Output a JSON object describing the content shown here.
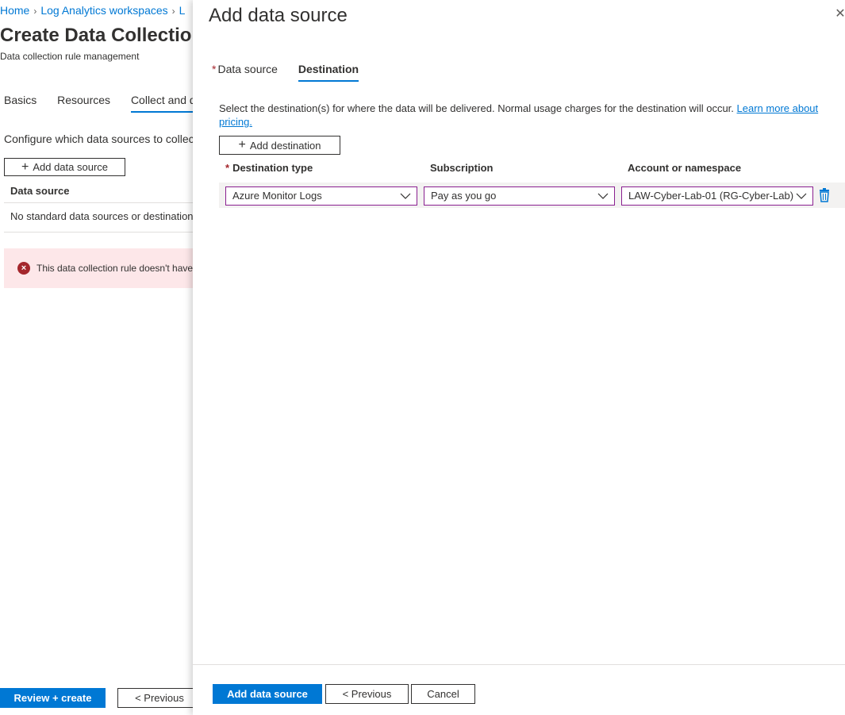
{
  "background": {
    "breadcrumb": [
      "Home",
      "Log Analytics workspaces",
      "L"
    ],
    "title": "Create Data Collection",
    "subtitle": "Data collection rule management",
    "tabs": [
      "Basics",
      "Resources",
      "Collect and de"
    ],
    "description": "Configure which data sources to collec",
    "add_button": "Add data source",
    "table_header": "Data source",
    "empty_row": "No standard data sources or destination",
    "error_text": "This data collection rule doesn't have",
    "footer": {
      "primary": "Review + create",
      "previous": "< Previous"
    }
  },
  "blade": {
    "title": "Add data source",
    "tabs": [
      {
        "label": "Data source",
        "required": "*"
      },
      {
        "label": "Destination"
      }
    ],
    "description": "Select the destination(s) for where the data will be delivered. Normal usage charges for the destination will occur.",
    "learn_more": "Learn more about pricing.",
    "add_destination": "Add destination",
    "columns": {
      "type": "Destination type",
      "type_required": "*",
      "subscription": "Subscription",
      "account": "Account or namespace"
    },
    "row": {
      "type": "Azure Monitor Logs",
      "subscription": "Pay as you go",
      "account": "LAW-Cyber-Lab-01 (RG-Cyber-Lab)"
    },
    "footer": {
      "primary": "Add data source",
      "previous": "< Previous",
      "cancel": "Cancel"
    }
  },
  "colors": {
    "accent": "#0078d4",
    "dropdown_border": "#8a2090",
    "error_bg": "#fde7e9",
    "error_icon": "#a4262c"
  },
  "icons": {
    "close": "close-icon",
    "plus": "plus-icon",
    "chevron": "chevron-down-icon",
    "trash": "trash-icon",
    "error": "error-circle-icon"
  }
}
